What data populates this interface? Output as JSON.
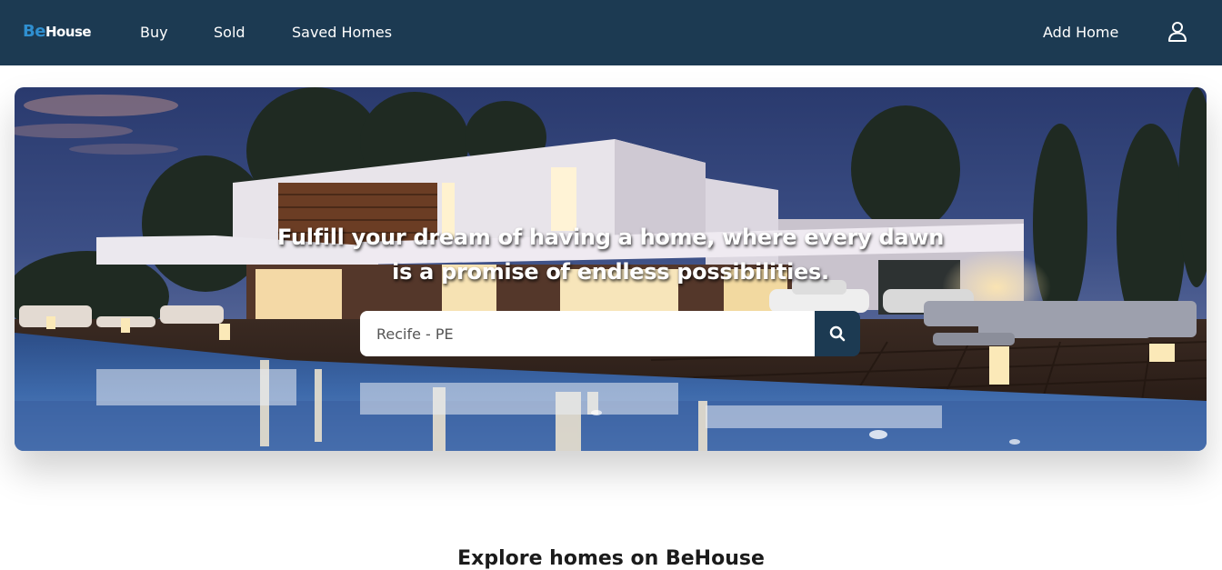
{
  "brand": {
    "logo_prefix": "Be",
    "logo_suffix": "House"
  },
  "nav": {
    "links": [
      "Buy",
      "Sold",
      "Saved Homes"
    ],
    "add_home": "Add Home",
    "user_icon": "user-icon"
  },
  "hero": {
    "headline_line1": "Fulfill your dream of having a home, where every dawn",
    "headline_line2": "is a promise of endless possibilities.",
    "search": {
      "value": "Recife - PE",
      "icon": "search-icon"
    }
  },
  "section": {
    "heading": "Explore homes on BeHouse"
  },
  "colors": {
    "navbar": "#1c3a52",
    "brand_accent": "#2f8fd0",
    "search_button": "#1c3a52"
  }
}
